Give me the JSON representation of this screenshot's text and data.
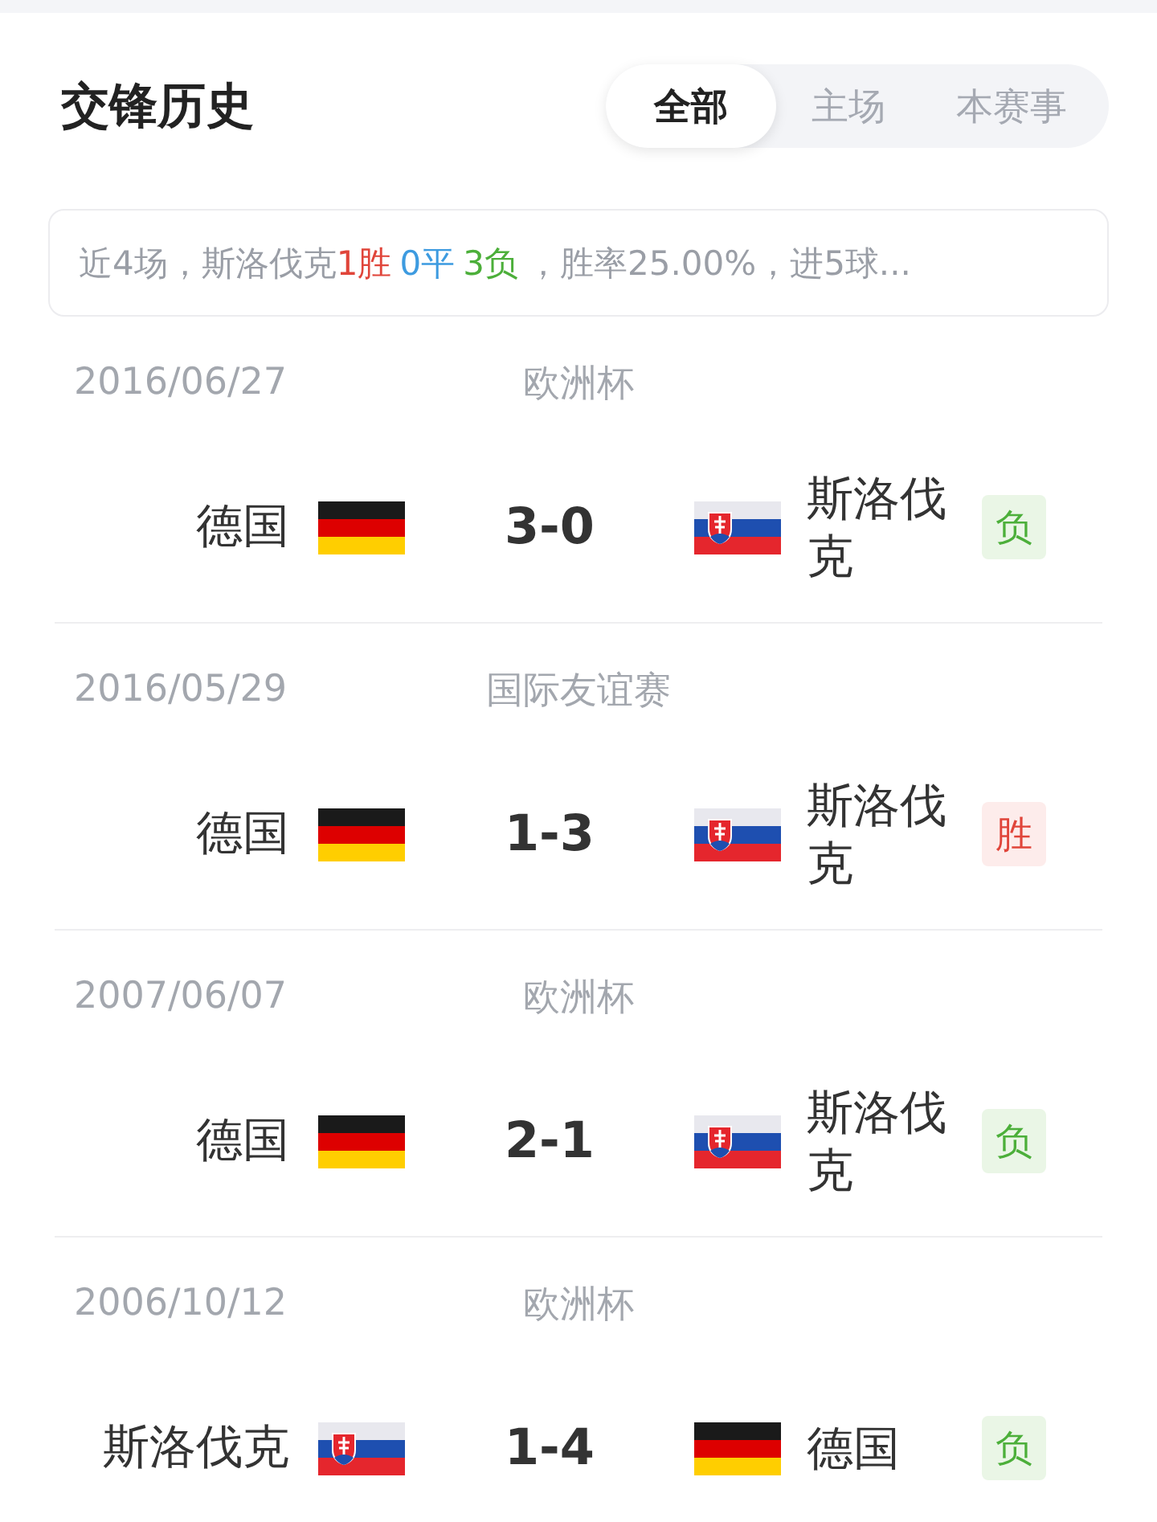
{
  "title": "交锋历史",
  "tabs": [
    {
      "label": "全部",
      "selected": true
    },
    {
      "label": "主场",
      "selected": false
    },
    {
      "label": "本赛事",
      "selected": false
    }
  ],
  "summary": [
    {
      "text": "近4场，斯洛伐克",
      "kind": "plain"
    },
    {
      "text": "1胜",
      "kind": "win"
    },
    {
      "text": "0平",
      "kind": "draw"
    },
    {
      "text": "3负",
      "kind": "loss"
    },
    {
      "text": "，胜率25.00%，进5球...",
      "kind": "plain"
    }
  ],
  "matches": [
    {
      "date": "2016/06/27",
      "competition": "欧洲杯",
      "home": {
        "name": "德国",
        "kind": "germany"
      },
      "score": "3-0",
      "away": {
        "name": "斯洛伐克",
        "kind": "slovakia"
      },
      "result": {
        "label": "负",
        "kind": "loss"
      }
    },
    {
      "date": "2016/05/29",
      "competition": "国际友谊赛",
      "home": {
        "name": "德国",
        "kind": "germany"
      },
      "score": "1-3",
      "away": {
        "name": "斯洛伐克",
        "kind": "slovakia"
      },
      "result": {
        "label": "胜",
        "kind": "win"
      }
    },
    {
      "date": "2007/06/07",
      "competition": "欧洲杯",
      "home": {
        "name": "德国",
        "kind": "germany"
      },
      "score": "2-1",
      "away": {
        "name": "斯洛伐克",
        "kind": "slovakia"
      },
      "result": {
        "label": "负",
        "kind": "loss"
      }
    },
    {
      "date": "2006/10/12",
      "competition": "欧洲杯",
      "home": {
        "name": "斯洛伐克",
        "kind": "slovakia"
      },
      "score": "1-4",
      "away": {
        "name": "德国",
        "kind": "germany"
      },
      "result": {
        "label": "负",
        "kind": "loss"
      }
    }
  ]
}
